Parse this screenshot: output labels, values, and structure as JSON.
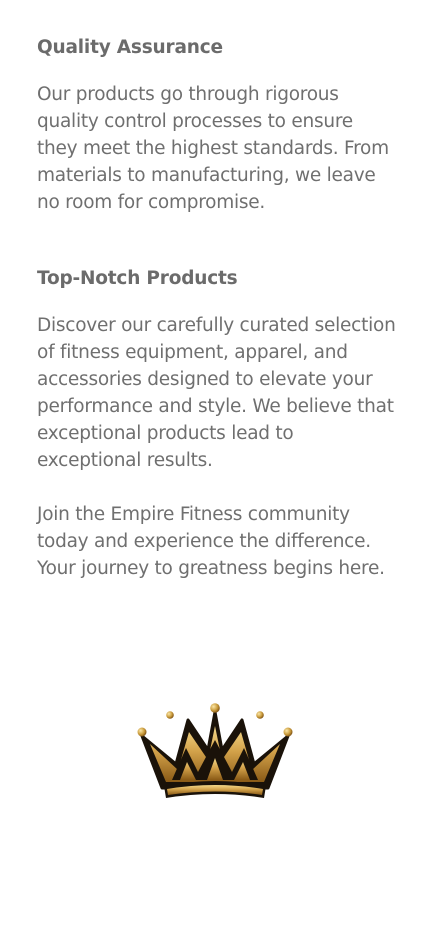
{
  "sections": {
    "quality": {
      "title": "Quality Assurance",
      "text": "Our products go through rigorous quality control processes to ensure they meet the highest standards. From materials to manufacturing, we leave no room for compromise."
    },
    "products": {
      "title": "Top-Notch Products",
      "text": "Discover our carefully curated selection of fitness equipment, apparel, and accessories designed to elevate your performance and style. We believe that exceptional products lead to exceptional results."
    },
    "community": {
      "text": "Join the Empire Fitness community today and experience the difference. Your journey to greatness begins here."
    }
  },
  "logo": {
    "icon": "crown-icon",
    "colors": {
      "gold": "#c99a3a",
      "gold_light": "#f1d27a",
      "gold_dark": "#8a5a16",
      "outline": "#1a1209"
    }
  }
}
